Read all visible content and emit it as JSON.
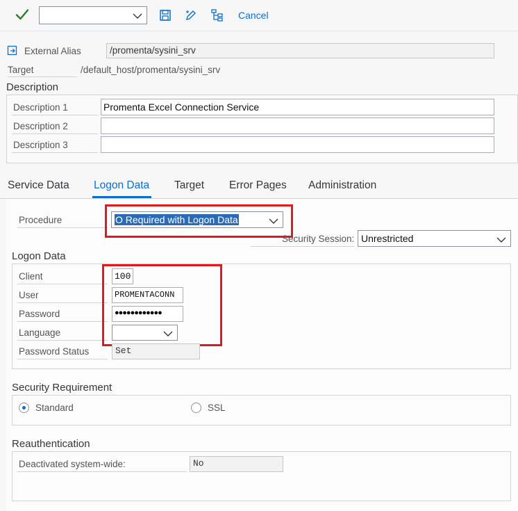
{
  "toolbar": {
    "select_value": "",
    "cancel_label": "Cancel"
  },
  "header": {
    "external_alias_label": "External Alias",
    "external_alias_value": "/promenta/sysini_srv",
    "target_label": "Target",
    "target_value": "/default_host/promenta/sysini_srv"
  },
  "description": {
    "title": "Description",
    "fields": [
      {
        "label": "Description 1",
        "value": "Promenta Excel Connection Service"
      },
      {
        "label": "Description 2",
        "value": ""
      },
      {
        "label": "Description 3",
        "value": ""
      }
    ]
  },
  "tabs": [
    {
      "label": "Service Data",
      "active": false
    },
    {
      "label": "Logon Data",
      "active": true
    },
    {
      "label": "Target",
      "active": false
    },
    {
      "label": "Error Pages",
      "active": false
    },
    {
      "label": "Administration",
      "active": false
    }
  ],
  "procedure": {
    "label": "Procedure",
    "value": "O Required with Logon Data"
  },
  "security_session": {
    "label": "Security Session:",
    "value": "Unrestricted"
  },
  "logon_data": {
    "title": "Logon Data",
    "client_label": "Client",
    "client_value": "100",
    "user_label": "User",
    "user_value": "PROMENTACONN",
    "password_label": "Password",
    "password_value": "●●●●●●●●●●●●",
    "language_label": "Language",
    "language_value": "",
    "password_status_label": "Password Status",
    "password_status_value": "Set"
  },
  "security_requirement": {
    "title": "Security Requirement",
    "options": [
      {
        "label": "Standard",
        "selected": true
      },
      {
        "label": "SSL",
        "selected": false
      }
    ]
  },
  "reauthentication": {
    "title": "Reauthentication",
    "deactivated_label": "Deactivated system-wide:",
    "deactivated_value": "No"
  },
  "colors": {
    "accent": "#0a6ed1",
    "highlight": "#e0191c",
    "check": "#2b7d2b"
  },
  "icons": {
    "confirm": "check-icon",
    "save": "save-icon",
    "edit": "edit-icon",
    "hierarchy": "hierarchy-icon",
    "external_alias": "external-alias-icon"
  }
}
